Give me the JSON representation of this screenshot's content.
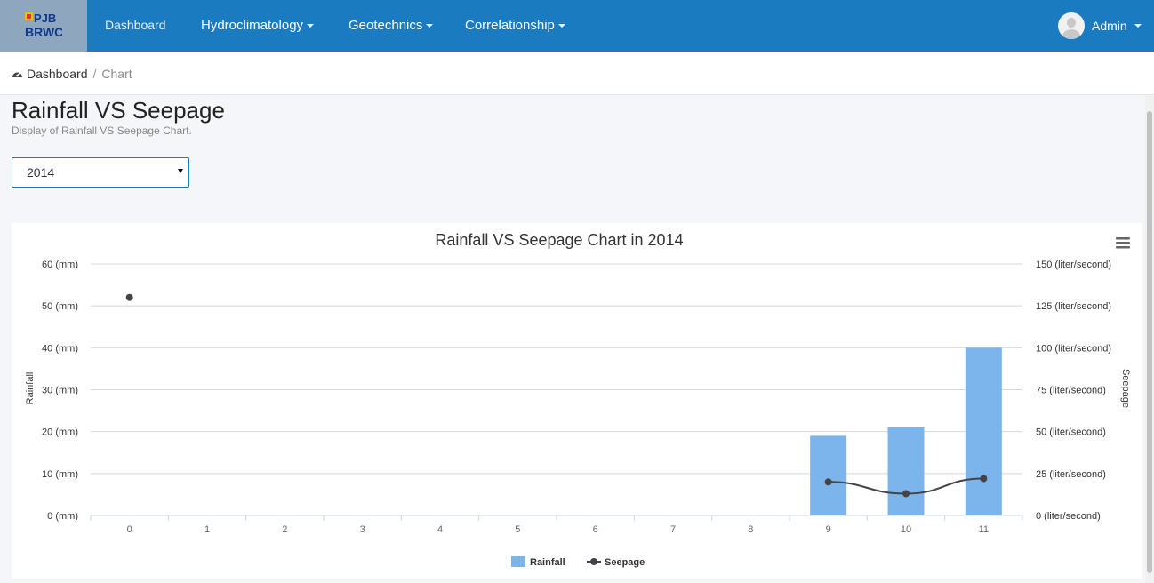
{
  "nav": {
    "logo_text": "PJB BRWC",
    "items": [
      {
        "label": "Dashboard"
      },
      {
        "label": "Hydroclimatology"
      },
      {
        "label": "Geotechnics"
      },
      {
        "label": "Correlationship"
      }
    ],
    "user": "Admin"
  },
  "breadcrumb": {
    "home": "Dashboard",
    "sep": "/",
    "current": "Chart"
  },
  "page": {
    "title": "Rainfall VS Seepage",
    "subtitle": "Display of Rainfall VS Seepage Chart."
  },
  "year_select": {
    "value": "2014"
  },
  "chart_data": {
    "type": "bar",
    "title": "Rainfall VS Seepage Chart in 2014",
    "categories": [
      "0",
      "1",
      "2",
      "3",
      "4",
      "5",
      "6",
      "7",
      "8",
      "9",
      "10",
      "11"
    ],
    "ylabel_left": "Rainfall",
    "ylabel_right": "Seepage",
    "yticks_left": [
      "0 (mm)",
      "10 (mm)",
      "20 (mm)",
      "30 (mm)",
      "40 (mm)",
      "50 (mm)",
      "60 (mm)"
    ],
    "yticks_right": [
      "0 (liter/second)",
      "25 (liter/second)",
      "50 (liter/second)",
      "75 (liter/second)",
      "100 (liter/second)",
      "125 (liter/second)",
      "150 (liter/second)"
    ],
    "ylim_left": [
      0,
      60
    ],
    "ylim_right": [
      0,
      150
    ],
    "grid": true,
    "legend_position": "bottom",
    "series": [
      {
        "name": "Rainfall",
        "type": "bar",
        "axis": "left",
        "color": "#7cb5ec",
        "values": [
          null,
          null,
          null,
          null,
          null,
          null,
          null,
          null,
          null,
          19,
          21,
          40
        ]
      },
      {
        "name": "Seepage",
        "type": "line",
        "axis": "right",
        "color": "#434348",
        "values": [
          130,
          null,
          null,
          null,
          null,
          null,
          null,
          null,
          null,
          20,
          13,
          22
        ]
      }
    ]
  }
}
